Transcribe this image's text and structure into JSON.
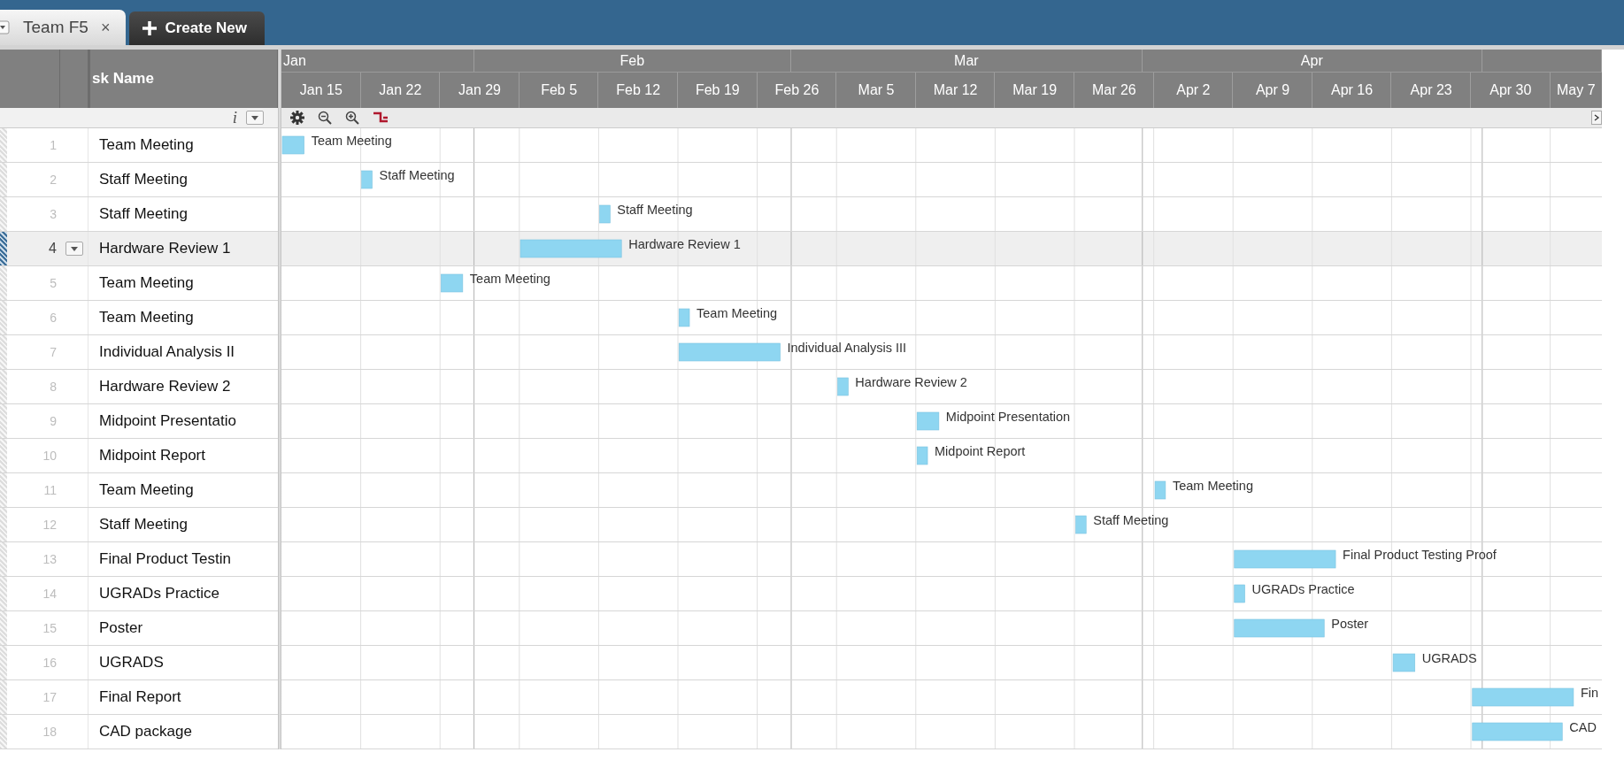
{
  "tabs": [
    {
      "label": "Team F5",
      "close": "×",
      "selected": true
    }
  ],
  "create_button": {
    "label": "Create New"
  },
  "grid": {
    "columns": [
      "sk Name"
    ],
    "info_label": "i",
    "rows": [
      {
        "number": "1",
        "name": "Team Meeting",
        "selected": false
      },
      {
        "number": "2",
        "name": "Staff Meeting",
        "selected": false
      },
      {
        "number": "3",
        "name": "Staff Meeting",
        "selected": false
      },
      {
        "number": "4",
        "name": "Hardware Review 1",
        "selected": true
      },
      {
        "number": "5",
        "name": "Team Meeting",
        "selected": false
      },
      {
        "number": "6",
        "name": "Team Meeting",
        "selected": false
      },
      {
        "number": "7",
        "name": "Individual Analysis II",
        "selected": false
      },
      {
        "number": "8",
        "name": "Hardware Review 2",
        "selected": false
      },
      {
        "number": "9",
        "name": "Midpoint Presentatio",
        "selected": false
      },
      {
        "number": "10",
        "name": "Midpoint Report",
        "selected": false
      },
      {
        "number": "11",
        "name": "Team Meeting",
        "selected": false
      },
      {
        "number": "12",
        "name": "Staff Meeting",
        "selected": false
      },
      {
        "number": "13",
        "name": "Final Product Testin",
        "selected": false
      },
      {
        "number": "14",
        "name": "UGRADs Practice",
        "selected": false
      },
      {
        "number": "15",
        "name": "Poster",
        "selected": false
      },
      {
        "number": "16",
        "name": "UGRADS",
        "selected": false
      },
      {
        "number": "17",
        "name": "Final Report",
        "selected": false
      },
      {
        "number": "18",
        "name": "CAD package",
        "selected": false
      }
    ]
  },
  "timeline": {
    "months": [
      "Jan",
      "Feb",
      "Mar",
      "Apr"
    ],
    "weeks": [
      "Jan 15",
      "Jan 22",
      "Jan 29",
      "Feb 5",
      "Feb 12",
      "Feb 19",
      "Feb 26",
      "Mar 5",
      "Mar 12",
      "Mar 19",
      "Mar 26",
      "Apr 2",
      "Apr 9",
      "Apr 16",
      "Apr 23",
      "Apr 30",
      "May 7"
    ],
    "bars": [
      {
        "label": "Team Meeting",
        "start": {
          "level": 0
        },
        "end": {
          "level": 0.0172
        }
      },
      {
        "label": "Staff Meeting",
        "start": {
          "level": 0.0601
        },
        "end": {
          "level": 0.0687
        }
      },
      {
        "label": "Staff Meeting",
        "start": {
          "level": 0.2403
        },
        "end": {
          "level": 0.2489
        }
      },
      {
        "label": "Hardware Review 1",
        "start": {
          "level": 0.1803
        },
        "end": {
          "level": 0.2575
        }
      },
      {
        "label": "Team Meeting",
        "start": {
          "level": 0.1202
        },
        "end": {
          "level": 0.1373
        }
      },
      {
        "label": "Team Meeting",
        "start": {
          "level": 0.3004
        },
        "end": {
          "level": 0.309
        }
      },
      {
        "label": "Individual Analysis III",
        "start": {
          "level": 0.3004
        },
        "end": {
          "level": 0.3777
        }
      },
      {
        "label": "Hardware Review 2",
        "start": {
          "level": 0.4206
        },
        "end": {
          "level": 0.4292
        }
      },
      {
        "label": "Midpoint Presentation",
        "start": {
          "level": 0.4807
        },
        "end": {
          "level": 0.4979
        }
      },
      {
        "label": "Midpoint Report",
        "start": {
          "level": 0.4807
        },
        "end": {
          "level": 0.4893
        }
      },
      {
        "label": "Team Meeting",
        "start": {
          "level": 0.6609
        },
        "end": {
          "level": 0.6695
        }
      },
      {
        "label": "Staff Meeting",
        "start": {
          "level": 0.6009
        },
        "end": {
          "level": 0.6094
        }
      },
      {
        "label": "Final Product Testing Proof",
        "start": {
          "level": 0.721
        },
        "end": {
          "level": 0.7983
        }
      },
      {
        "label": "UGRADs Practice",
        "start": {
          "level": 0.721
        },
        "end": {
          "level": 0.7296
        }
      },
      {
        "label": "Poster",
        "start": {
          "level": 0.721
        },
        "end": {
          "level": 0.7897
        }
      },
      {
        "label": "UGRADS",
        "start": {
          "level": 0.8412
        },
        "end": {
          "level": 0.8584
        }
      },
      {
        "label": "Fin",
        "start": {
          "level": 0.9013
        },
        "end": {
          "level": 0.9785
        }
      },
      {
        "label": "CAD",
        "start": {
          "level": 0.9013
        },
        "end": {
          "level": 0.97
        }
      }
    ]
  }
}
